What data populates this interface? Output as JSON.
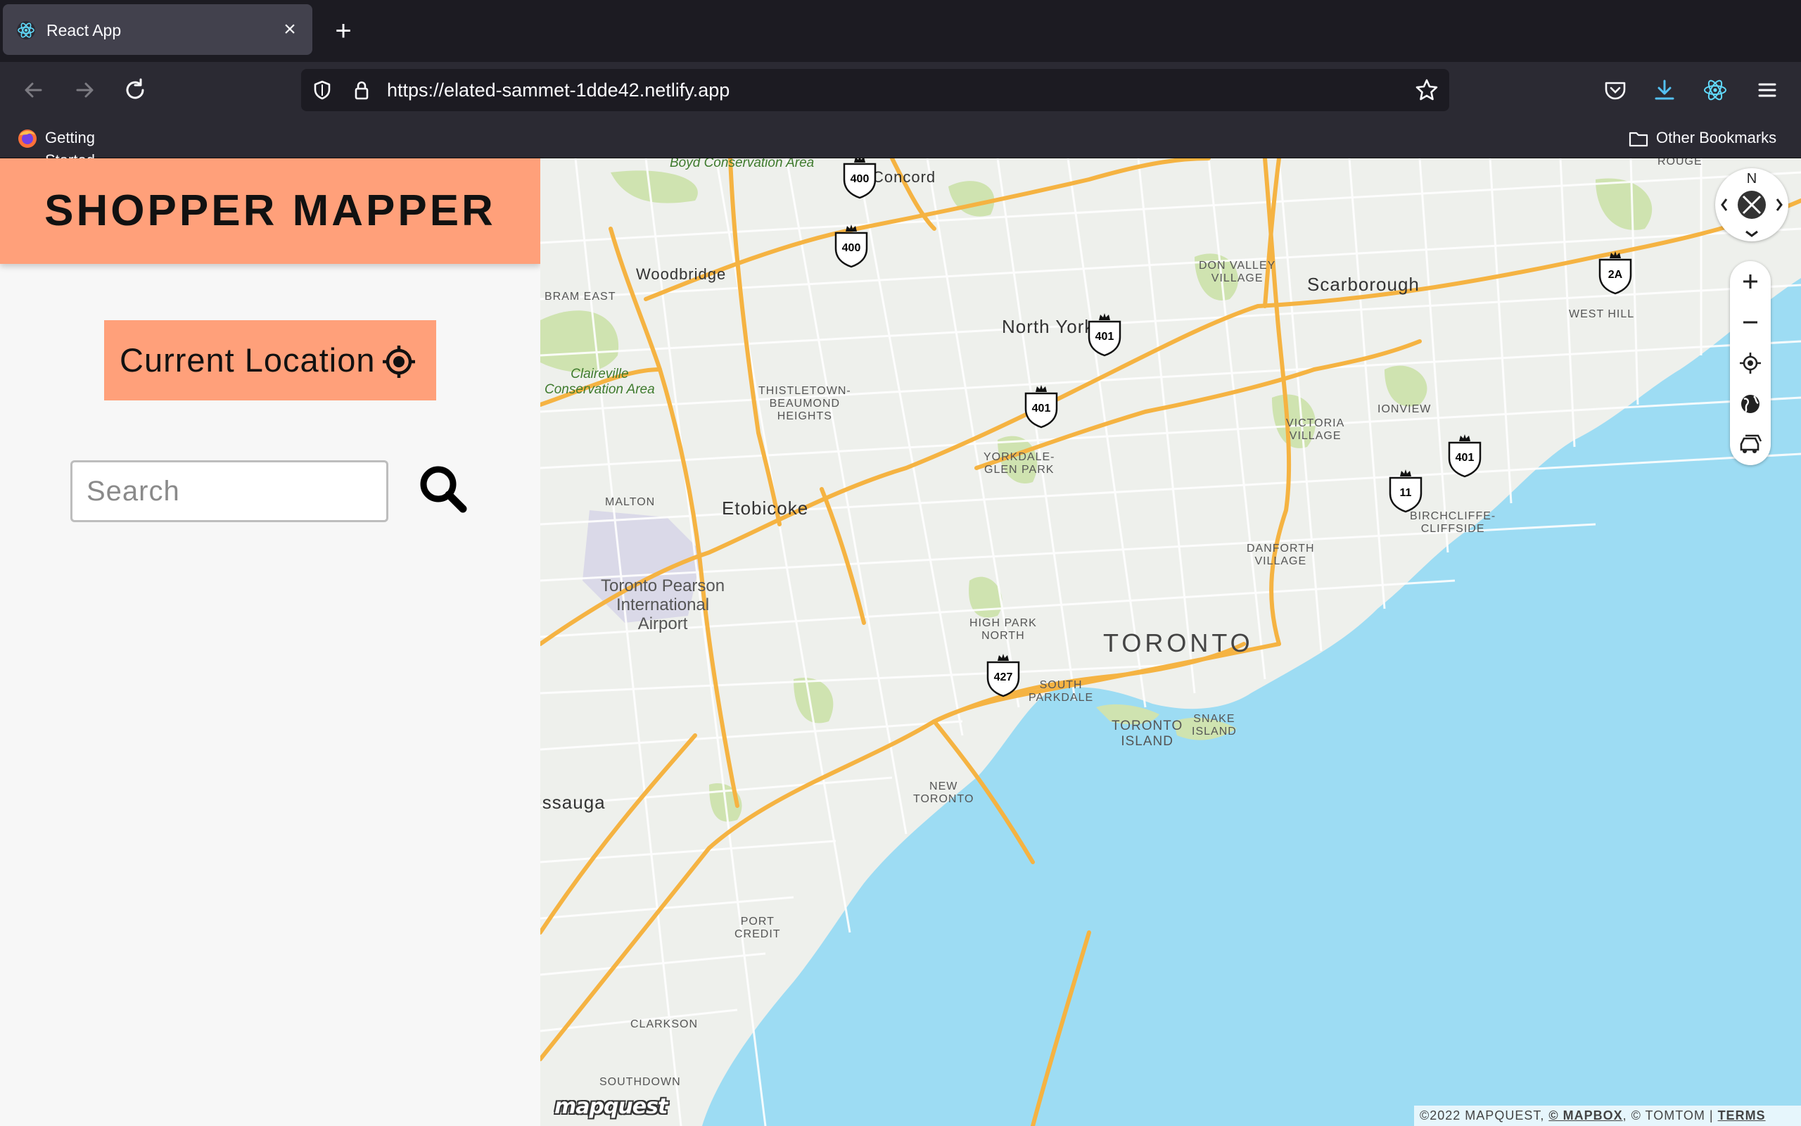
{
  "browser": {
    "tab_title": "React App",
    "tab_close": "×",
    "new_tab": "+",
    "url": "https://elated-sammet-1dde42.netlify.app",
    "bookmarks": [
      {
        "label": "Getting Started"
      },
      {
        "label": "Other Bookmarks"
      }
    ]
  },
  "app": {
    "title": "SHOPPER MAPPER",
    "current_location_label": "Current Location",
    "search_placeholder": "Search",
    "search_value": ""
  },
  "map": {
    "labels": {
      "concord": "Concord",
      "woodbridge": "Woodbridge",
      "bram_east": "BRAM EAST",
      "north_york": "North York",
      "don_valley": "DON VALLEY\nVILLAGE",
      "scarborough": "Scarborough",
      "west_hill": "WEST HILL",
      "rouge": "ROUGE",
      "thistletown": "THISTLETOWN-\nBEAUMOND\nHEIGHTS",
      "yorkdale": "YORKDALE-\nGLEN PARK",
      "victoria_village": "VICTORIA\nVILLAGE",
      "ionview": "IONVIEW",
      "malton": "MALTON",
      "etobicoke": "Etobicoke",
      "birchcliffe": "BIRCHCLIFFE-\nCLIFFSIDE",
      "danforth": "DANFORTH\nVILLAGE",
      "pearson": "Toronto Pearson\nInternational\nAirport",
      "high_park": "HIGH PARK\nNORTH",
      "toronto": "TORONTO",
      "south_parkdale": "SOUTH\nPARKDALE",
      "toronto_island": "TORONTO\nISLAND",
      "snake_island": "SNAKE\nISLAND",
      "mississauga": "issauga",
      "new_toronto": "NEW\nTORONTO",
      "port_credit": "PORT\nCREDIT",
      "clarkson": "CLARKSON",
      "southdown": "SOUTHDOWN",
      "boyd": "Boyd Conservation\nArea",
      "claireville": "Claireville\nConservation Area"
    },
    "shields": [
      {
        "num": "400"
      },
      {
        "num": "400"
      },
      {
        "num": "401"
      },
      {
        "num": "401"
      },
      {
        "num": "401"
      },
      {
        "num": "11"
      },
      {
        "num": "427"
      },
      {
        "num": "2A"
      }
    ],
    "compass_label": "N",
    "logo": "mapquest",
    "attribution": {
      "text": "©2022 MAPQUEST, ",
      "mapbox": "© MAPBOX",
      "tomtom": ", © TOMTOM | ",
      "terms": "TERMS"
    }
  },
  "colors": {
    "header_bg": "#ffa07a",
    "water": "#9ddcf3",
    "highway": "#f5b342",
    "park": "#cfe3b0"
  }
}
